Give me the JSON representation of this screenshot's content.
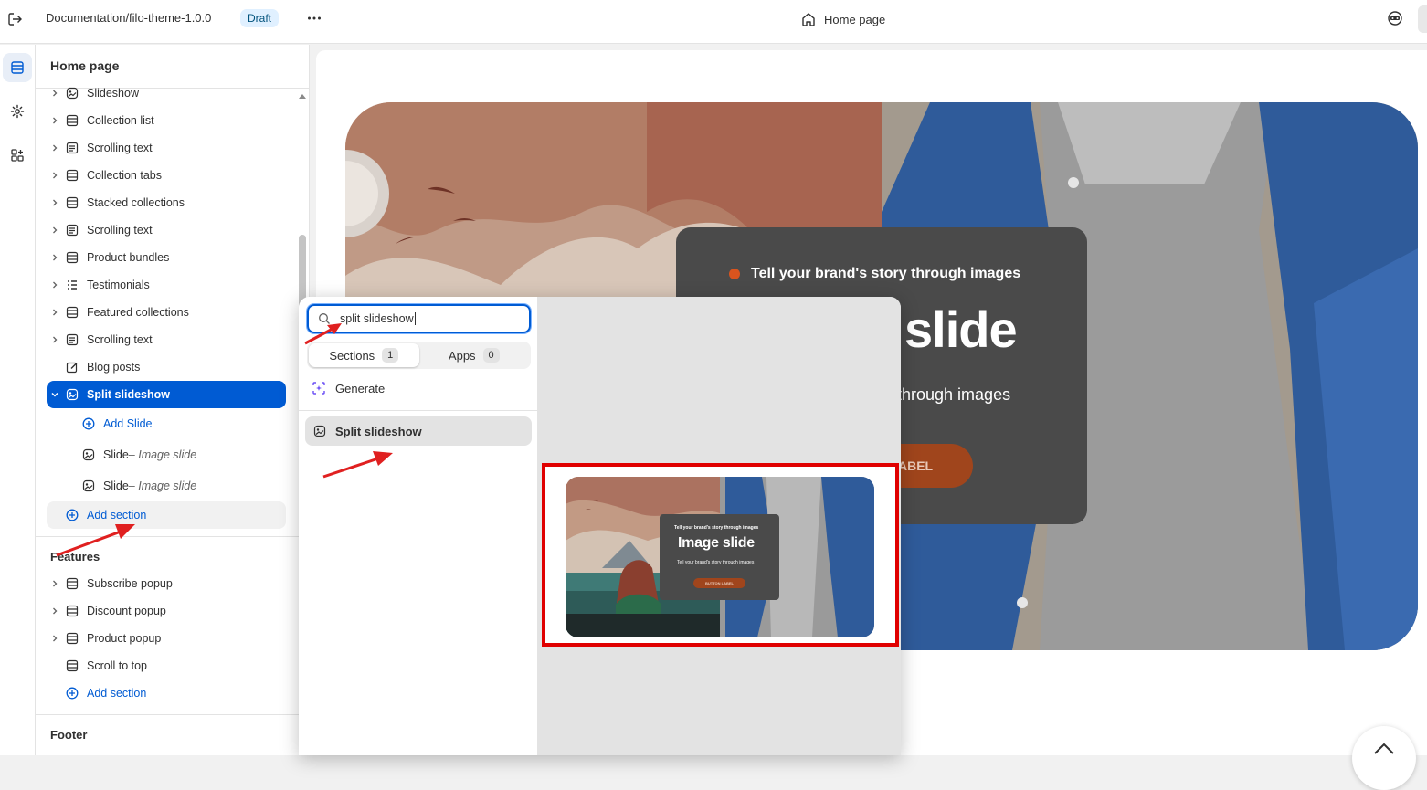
{
  "topbar": {
    "theme_name": "Documentation/filo-theme-1.0.0",
    "status_badge": "Draft",
    "page_selector": "Home page"
  },
  "sidebar": {
    "title": "Home page",
    "template_items": [
      {
        "label": "Slideshow",
        "icon": "slideshow-icon"
      },
      {
        "label": "Collection list",
        "icon": "section-icon"
      },
      {
        "label": "Scrolling text",
        "icon": "text-icon"
      },
      {
        "label": "Collection tabs",
        "icon": "section-icon"
      },
      {
        "label": "Stacked collections",
        "icon": "section-icon"
      },
      {
        "label": "Scrolling text",
        "icon": "text-icon"
      },
      {
        "label": "Product bundles",
        "icon": "section-icon"
      },
      {
        "label": "Testimonials",
        "icon": "list-icon"
      },
      {
        "label": "Featured collections",
        "icon": "section-icon"
      },
      {
        "label": "Scrolling text",
        "icon": "text-icon"
      },
      {
        "label": "Blog posts",
        "icon": "blog-icon"
      }
    ],
    "selected_item": "Split slideshow",
    "add_slide": "Add Slide",
    "slides": [
      {
        "name": "Slide",
        "detail": " – Image slide"
      },
      {
        "name": "Slide",
        "detail": " – Image slide"
      }
    ],
    "add_section": "Add section",
    "features_title": "Features",
    "feature_items": [
      {
        "label": "Subscribe popup"
      },
      {
        "label": "Discount popup"
      },
      {
        "label": "Product popup"
      },
      {
        "label": "Scroll to top"
      }
    ],
    "features_add_section": "Add section",
    "footer_title": "Footer"
  },
  "popover": {
    "search_value": "split slideshow",
    "tabs": [
      {
        "label": "Sections",
        "count": "1"
      },
      {
        "label": "Apps",
        "count": "0"
      }
    ],
    "generate_label": "Generate",
    "result_label": "Split slideshow"
  },
  "preview": {
    "eyebrow": "Tell your brand's story through images",
    "title": "slide",
    "subtitle": "through images",
    "button": "ABEL"
  },
  "thumbnail": {
    "eyebrow": "Tell your brand's story through images",
    "title": "Image slide",
    "subtitle": "Tell your brand's story through images",
    "button": "BUTTON LABEL"
  },
  "colors": {
    "accent": "#005bd3",
    "highlight_frame": "#e00000",
    "annotation_arrow": "#e02020",
    "hero_dot": "#d9541e"
  }
}
